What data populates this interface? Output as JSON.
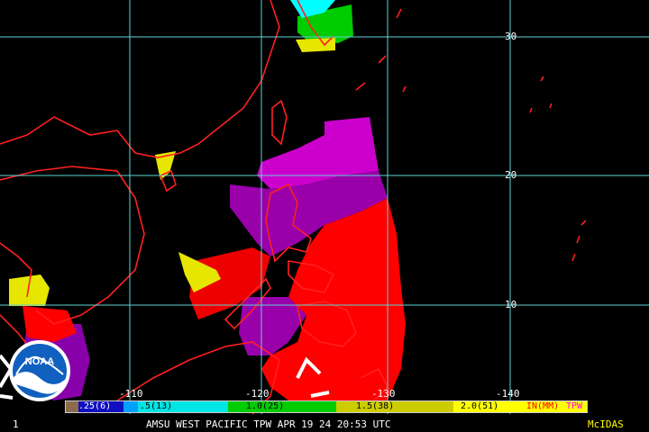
{
  "map": {
    "latitude_labels": [
      "30",
      "20",
      "10"
    ],
    "longitude_labels": [
      "-110",
      "-120",
      "-130",
      "-140"
    ]
  },
  "legend": {
    "segments": [
      {
        "label": ".25(6)",
        "color": "#8b4513"
      },
      {
        "label": ".5(13)",
        "color": "#00ffff"
      },
      {
        "label": "1.0(25)",
        "color": "#00cc00"
      },
      {
        "label": "1.5(38)",
        "color": "#cccc00"
      },
      {
        "label": "2.0(51)",
        "color": "#ff0000"
      }
    ],
    "units_label": "IN(MM)",
    "product_label": "TPW"
  },
  "footer": {
    "frame_number": "1",
    "title": "AMSU WEST PACIFIC   TPW APR 19 24 20:53 UTC",
    "software": "McIDAS"
  },
  "logo": {
    "text": "NOAA"
  },
  "colors": {
    "grid": "#5fd3d3",
    "coastline": "#ff2020",
    "tpw_magenta": "#c000c0",
    "tpw_purple": "#9900aa",
    "tpw_red": "#ff0000",
    "tpw_yellow": "#e6e600",
    "tpw_green": "#00cc00",
    "tpw_cyan": "#00ffff"
  }
}
